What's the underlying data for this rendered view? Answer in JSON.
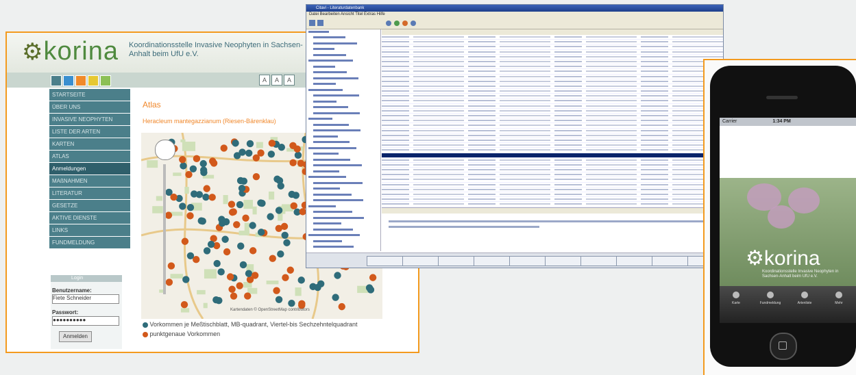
{
  "website": {
    "logo": "korina",
    "subtitle": "Koordinationsstelle Invasive Neophyten in Sachsen-Anhalt beim UfU e.V.",
    "menu": [
      "STARTSEITE",
      "ÜBER UNS",
      "INVASIVE NEOPHYTEN",
      "LISTE DER ARTEN",
      "KARTEN",
      "ATLAS",
      "Anmeldungen",
      "MAßNAHMEN",
      "LITERATUR",
      "GESETZE",
      "AKTIVE DIENSTE",
      "LINKS",
      "FUNDMELDUNG"
    ],
    "active_menu_index": 6,
    "page_title": "Atlas",
    "page_subtitle": "Heracleum mantegazzianum (Riesen-Bärenklau)",
    "login": {
      "header": "Login",
      "username_label": "Benutzername:",
      "username_value": "Fiete Schneider",
      "password_label": "Passwort:",
      "password_value": "●●●●●●●●●●",
      "submit_label": "Anmelden"
    },
    "legend": [
      {
        "text": "Vorkommen je Meßtischblatt, MB-quadrant, Viertel-bis Sechzehntelquadrant",
        "color": "#2f6c7a"
      },
      {
        "text": "punktgenaue Vorkommen",
        "color": "#d2591b"
      }
    ],
    "map_caption": "Kartendaten © OpenStreetMap contributors"
  },
  "app": {
    "window_title": "Citavi - Literaturdatenbank",
    "menu": "Datei  Bearbeiten  Ansicht  Titel  Extras  Hilfe",
    "selected_row_index": 24
  },
  "phone": {
    "carrier": "Carrier",
    "time": "1:34 PM",
    "logo": "korina",
    "tagline": "Koordinationsstelle Invasive Neophyten in Sachsen-Anhalt beim UfU e.V.",
    "tabs": [
      "Karte",
      "Fundmeldung",
      "Artenliste",
      "Mehr"
    ]
  },
  "colors": {
    "accent": "#f39a1e",
    "nav": "#4b7f8a",
    "teal_dot": "#2f6c7a",
    "orange_dot": "#d2591b"
  }
}
